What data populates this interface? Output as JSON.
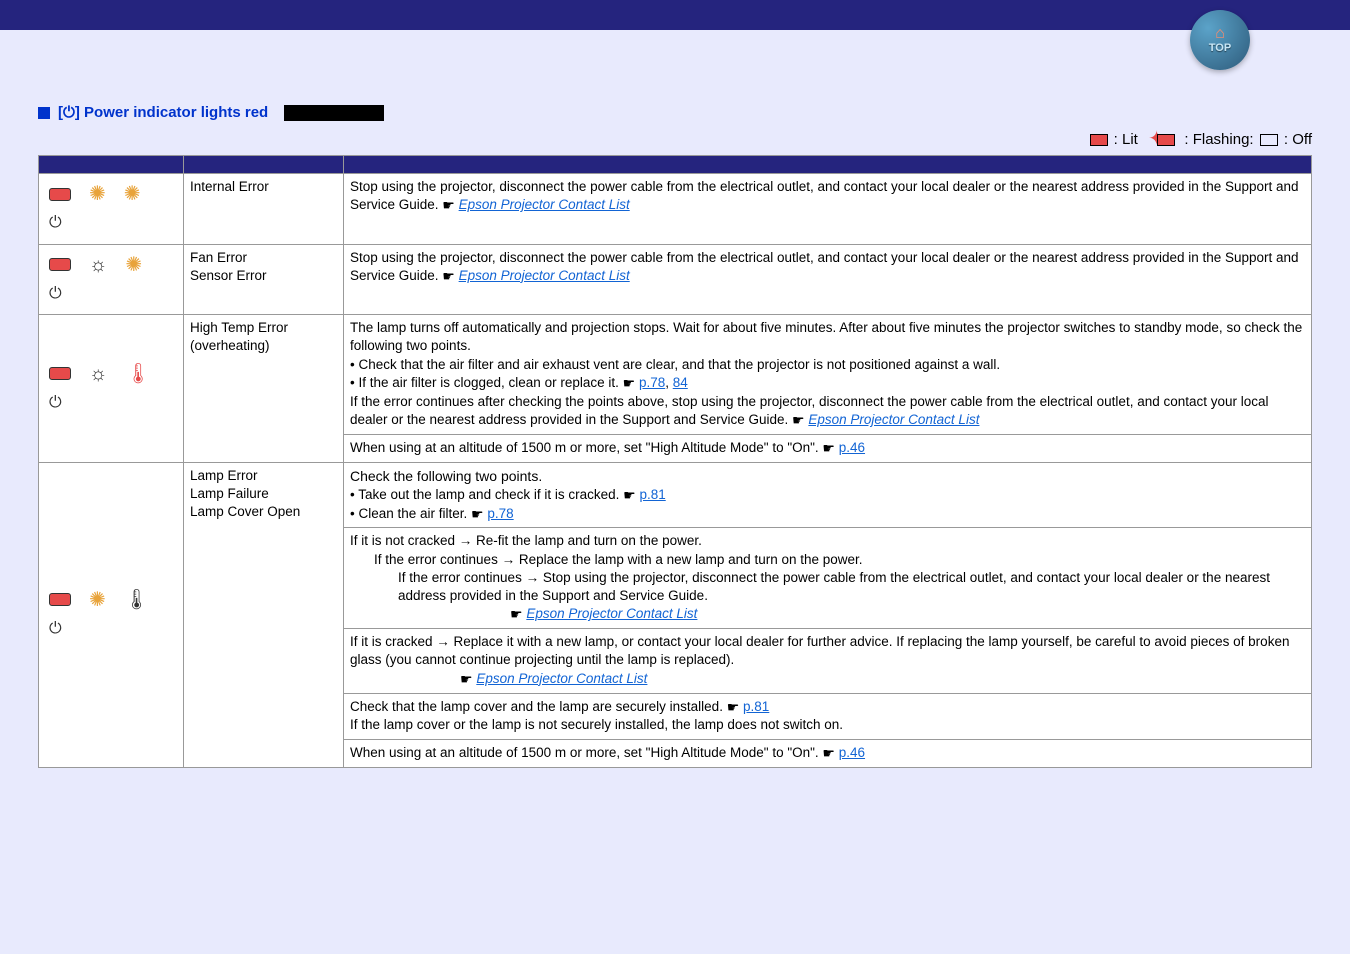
{
  "badge": {
    "top_label": "TOP"
  },
  "section": {
    "title": "[⏻] Power indicator lights red"
  },
  "legend": {
    "lit": ": Lit",
    "flashing": ": Flashing:",
    "off": " : Off"
  },
  "headers": {
    "status": "",
    "cause": "",
    "remedy": ""
  },
  "rows": {
    "r1": {
      "cause": "Internal Error",
      "remedy_pre": "Stop using the projector, disconnect the power cable from the electrical outlet, and contact your local dealer or the nearest address provided in the Support and Service Guide. ",
      "link": "Epson Projector Contact List"
    },
    "r2": {
      "cause": "Fan Error\nSensor Error",
      "remedy_pre": "Stop using the projector, disconnect the power cable from the electrical outlet, and contact your local dealer or the nearest address provided in the Support and Service Guide. ",
      "link": "Epson Projector Contact List"
    },
    "r3": {
      "cause": "High Temp Error (overheating)",
      "p1": "The lamp turns off automatically and projection stops. Wait for about five minutes. After about five minutes the projector switches to standby mode, so check the following two points.",
      "b1": "• Check that the air filter and air exhaust vent are clear, and that the projector is not positioned against a wall.",
      "b2_pre": "• If the air filter is clogged, clean or replace it. ",
      "b2_link1": "p.78",
      "b2_sep": ", ",
      "b2_link2": "84",
      "p2_pre": "If the error continues after checking the points above, stop using the projector, disconnect the power cable from the electrical outlet, and contact your local dealer or the nearest address provided in the Support and Service Guide. ",
      "p2_link": "Epson Projector Contact List",
      "alt_pre": "When using at an altitude of 1500 m or more, set \"High Altitude Mode\" to \"On\". ",
      "alt_link": "p.46"
    },
    "r4": {
      "cause": "Lamp Error\nLamp Failure\nLamp Cover Open",
      "c1_t": "Check the following two points.",
      "c1_b1_pre": "• Take out the lamp and check if it is cracked. ",
      "c1_b1_link": "p.81",
      "c1_b2_pre": "• Clean the air filter. ",
      "c1_b2_link": "p.78",
      "c2_l1": "If it is not cracked → Re-fit the lamp and turn on the power.",
      "c2_l2": "If the error continues → Replace the lamp with a new lamp and turn on the power.",
      "c2_l3": "If the error continues → Stop using the projector, disconnect the power cable from the electrical outlet, and contact your local dealer or the nearest address provided in the Support and Service Guide.",
      "c2_link": "Epson Projector Contact List",
      "c3_l1": "If it is cracked → Replace it with a new lamp, or contact your local dealer for further advice. If replacing the lamp yourself, be careful to avoid pieces of broken glass (you cannot continue projecting until the lamp is replaced).",
      "c3_link": "Epson Projector Contact List",
      "c4_pre": "Check that the lamp cover and the lamp are securely installed. ",
      "c4_link": "p.81",
      "c4_p2": "If the lamp cover or the lamp is not securely installed, the lamp does not switch on.",
      "c5_pre": "When using at an altitude of 1500 m or more, set \"High Altitude Mode\" to \"On\". ",
      "c5_link": "p.46"
    }
  }
}
